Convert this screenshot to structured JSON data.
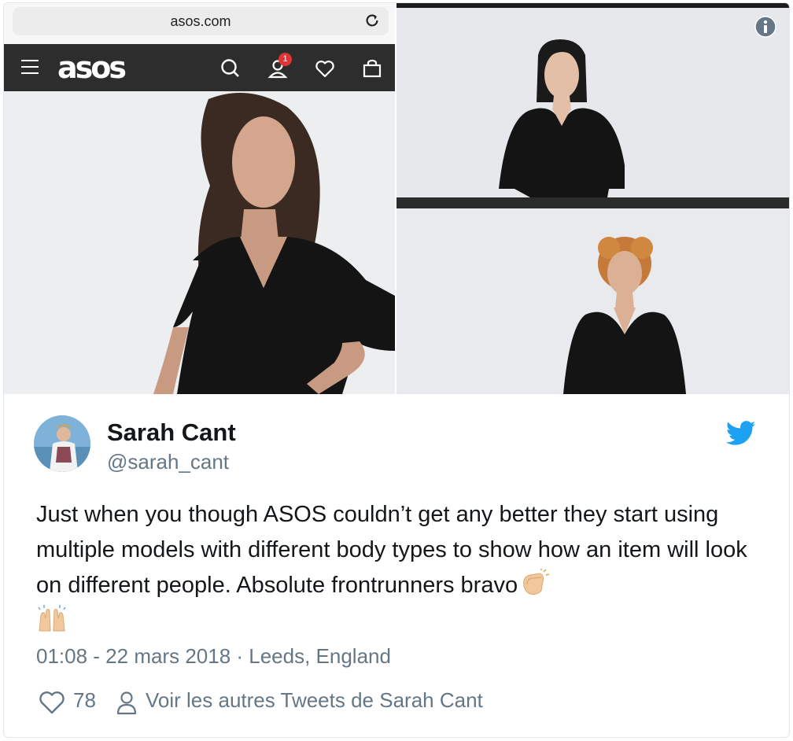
{
  "browser": {
    "url": "asos.com"
  },
  "asos_nav": {
    "logo": "asos",
    "badge_count": "1",
    "icons": [
      "hamburger-menu-icon",
      "search-icon",
      "account-icon",
      "heart-icon",
      "bag-icon"
    ]
  },
  "media": {
    "info_icon": "info-icon"
  },
  "tweet": {
    "author_name": "Sarah Cant",
    "author_handle": "@sarah_cant",
    "text": "Just when you though ASOS couldn’t get any better they start using multiple models with different body types to show how an item will look on different people. Absolute frontrunners bravo",
    "timestamp": "01:08 - 22 mars 2018 · Leeds, England",
    "like_count": "78",
    "view_more_label": "Voir les autres Tweets de Sarah Cant",
    "brand_color": "#1da1f2"
  }
}
